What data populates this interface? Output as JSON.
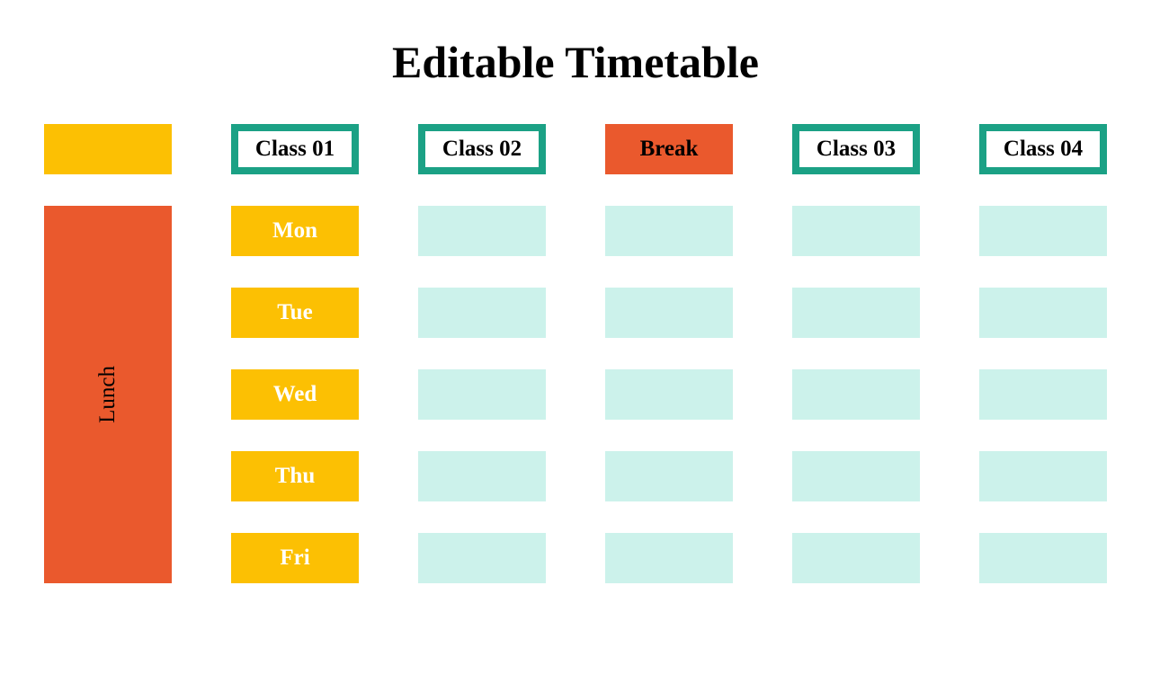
{
  "title": "Editable Timetable",
  "headers": {
    "class1": "Class 01",
    "class2": "Class 02",
    "break": "Break",
    "class3": "Class 03",
    "class4": "Class 04"
  },
  "days": {
    "mon": "Mon",
    "tue": "Tue",
    "wed": "Wed",
    "thu": "Thu",
    "fri": "Fri"
  },
  "lunch_label": "Lunch",
  "colors": {
    "day_bg": "#fcc003",
    "day_text": "#ffffff",
    "class_header_border": "#1ba185",
    "class_header_bg": "#ffffff",
    "break_bg": "#ea592d",
    "slot_bg": "#ccf2eb"
  }
}
